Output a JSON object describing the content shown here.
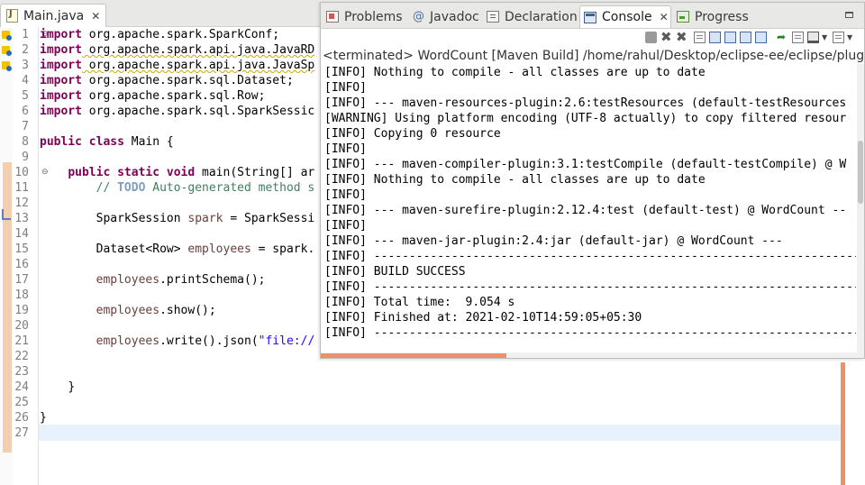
{
  "editor": {
    "tab_label": "Main.java",
    "line_numbers": [
      "1",
      "2",
      "3",
      "4",
      "5",
      "6",
      "7",
      "8",
      "9",
      "10",
      "11",
      "12",
      "13",
      "14",
      "15",
      "16",
      "17",
      "18",
      "19",
      "20",
      "21",
      "22",
      "23",
      "24",
      "25",
      "26",
      "27"
    ],
    "lines": {
      "l1": {
        "kw": "import",
        "rest": " org.apache.spark.SparkConf;"
      },
      "l2": {
        "kw": "import",
        "rest": " org.apache.spark.api.java.JavaRD"
      },
      "l3": {
        "kw": "import",
        "rest": " org.apache.spark.api.java.JavaSp"
      },
      "l4": {
        "kw": "import",
        "rest": " org.apache.spark.sql.Dataset;"
      },
      "l5": {
        "kw": "import",
        "rest": " org.apache.spark.sql.Row;"
      },
      "l6": {
        "kw": "import",
        "rest": " org.apache.spark.sql.SparkSessic"
      },
      "l8": {
        "kw": "public class",
        "rest": " Main {"
      },
      "l10": {
        "kw": "public static void",
        "rest": " main(String[] ar"
      },
      "l11": {
        "comment": "// ",
        "todo": "TODO",
        "rest": " Auto-generated method s"
      },
      "l13": {
        "type": "SparkSession ",
        "var": "spark",
        "rest": " = SparkSessi"
      },
      "l15": {
        "type": "Dataset<Row> ",
        "var": "employees",
        "rest": " = spark."
      },
      "l17": {
        "var": "employees",
        "rest": ".printSchema();"
      },
      "l19": {
        "var": "employees",
        "rest": ".show();"
      },
      "l21": {
        "var": "employees",
        "rest": ".write().json(",
        "str": "\"file://"
      },
      "l24": "}",
      "l26": "}"
    }
  },
  "console": {
    "tabs": [
      {
        "label": "Problems",
        "icon": "problems-icon"
      },
      {
        "label": "Javadoc",
        "icon": "at-sign-icon"
      },
      {
        "label": "Declaration",
        "icon": "declaration-icon"
      },
      {
        "label": "Console",
        "icon": "console-icon"
      },
      {
        "label": "Progress",
        "icon": "progress-icon"
      }
    ],
    "header": "<terminated> WordCount [Maven Build] /home/rahul/Desktop/eclipse-ee/eclipse/plugins",
    "output": [
      "[INFO] Nothing to compile - all classes are up to date",
      "[INFO]",
      "[INFO] --- maven-resources-plugin:2.6:testResources (default-testResources",
      "[WARNING] Using platform encoding (UTF-8 actually) to copy filtered resour",
      "[INFO] Copying 0 resource",
      "[INFO]",
      "[INFO] --- maven-compiler-plugin:3.1:testCompile (default-testCompile) @ W",
      "[INFO] Nothing to compile - all classes are up to date",
      "[INFO]",
      "[INFO] --- maven-surefire-plugin:2.12.4:test (default-test) @ WordCount --",
      "[INFO]",
      "[INFO] --- maven-jar-plugin:2.4:jar (default-jar) @ WordCount ---",
      "[INFO] ------------------------------------------------------------------------",
      "[INFO] BUILD SUCCESS",
      "[INFO] ------------------------------------------------------------------------",
      "[INFO] Total time:  9.054 s",
      "[INFO] Finished at: 2021-02-10T14:59:05+05:30",
      "[INFO] ------------------------------------------------------------------------"
    ]
  },
  "colors": {
    "keyword": "#7f0055",
    "comment": "#3f7f5f",
    "string": "#2a00ff",
    "accent": "#ef9167"
  }
}
